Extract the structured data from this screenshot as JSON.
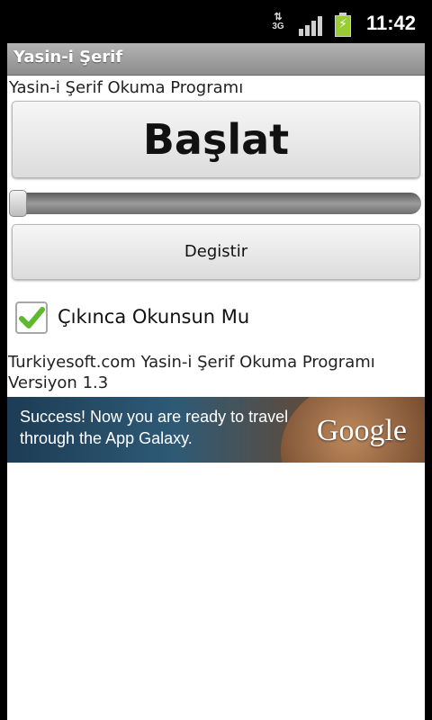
{
  "status_bar": {
    "network": "3G",
    "network_arrows": "⇅",
    "battery_bolt": "⚡",
    "time": "11:42",
    "icons": [
      "3g-data-icon",
      "signal-strength-icon",
      "battery-charging-icon"
    ]
  },
  "app": {
    "title": "Yasin-i Şerif",
    "header_text": "Yasin-i Şerif Okuma Programı",
    "start_button_label": "Başlat",
    "seekbar": {
      "progress": 0.0
    },
    "change_button_label": "Degistir",
    "checkbox": {
      "label": "Çıkınca Okunsun Mu",
      "checked": true
    },
    "info_line1": "Turkiyesoft.com Yasin-i Şerif Okuma Programı",
    "info_line2": "Versiyon 1.3"
  },
  "ad": {
    "text": "Success! Now you are ready to travel through the App Galaxy.",
    "logo": "Google"
  },
  "colors": {
    "titlebar": "#9f9f9f",
    "checkmark": "#5fb82d",
    "background": "#ffffff"
  }
}
